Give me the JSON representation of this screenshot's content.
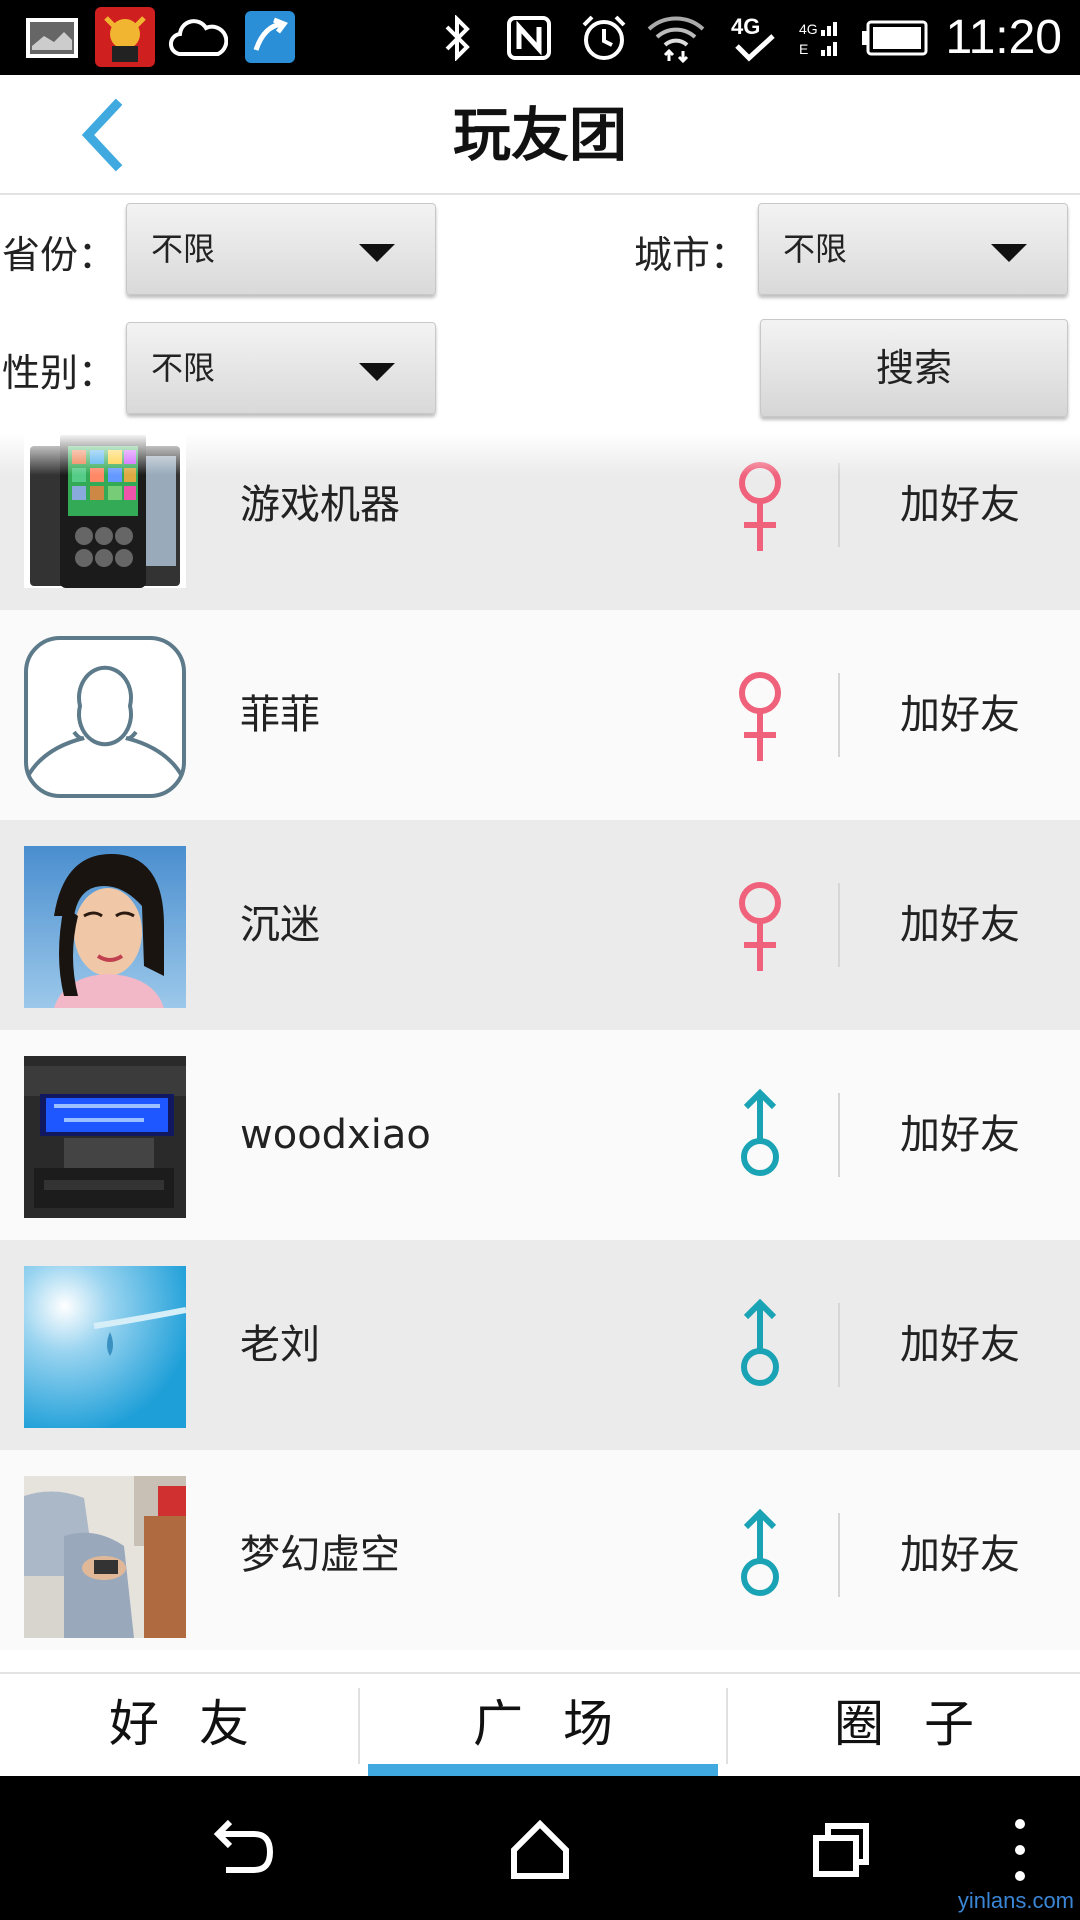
{
  "status_bar": {
    "time": "11:20",
    "icons": [
      "gallery-icon",
      "app-bull-icon",
      "cloud-icon",
      "app-arrow-icon",
      "bluetooth-icon",
      "nfc-icon",
      "alarm-icon",
      "wifi-icon",
      "4g-icon",
      "signal-icon",
      "battery-icon"
    ]
  },
  "header": {
    "title": "玩友团",
    "back_icon": "chevron-left-icon"
  },
  "filters": {
    "province_label": "省份：",
    "province_value": "不限",
    "city_label": "城市：",
    "city_value": "不限",
    "gender_label": "性别：",
    "gender_value": "不限",
    "search_label": "搜索"
  },
  "users": [
    {
      "name": "游戏机器",
      "gender": "female",
      "action": "加好友"
    },
    {
      "name": "菲菲",
      "gender": "female",
      "action": "加好友"
    },
    {
      "name": "沉迷",
      "gender": "female",
      "action": "加好友"
    },
    {
      "name": "woodxiao",
      "gender": "male",
      "action": "加好友"
    },
    {
      "name": "老刘",
      "gender": "male",
      "action": "加好友"
    },
    {
      "name": "梦幻虚空",
      "gender": "male",
      "action": "加好友"
    }
  ],
  "tabs": [
    {
      "label": "好友"
    },
    {
      "label": "广场",
      "active": true
    },
    {
      "label": "圈子"
    }
  ],
  "colors": {
    "accent": "#3fa9e0",
    "female": "#f0627c",
    "male": "#1aa3b5"
  },
  "watermark": "yinlans.com"
}
